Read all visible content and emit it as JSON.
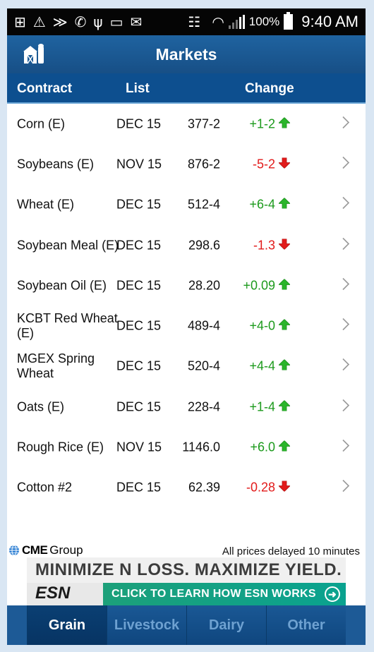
{
  "status_bar": {
    "icons": [
      "add-box-icon",
      "warning-icon",
      "sprint-icon",
      "missed-call-icon",
      "usb-icon",
      "voicemail-icon",
      "email-icon",
      "vibrate-icon",
      "wifi-icon",
      "signal-icon"
    ],
    "battery_pct": "100%",
    "time": "9:40 AM"
  },
  "header": {
    "title": "Markets",
    "logo_icon": "barn-silo-icon"
  },
  "columns": {
    "contract": "Contract",
    "list": "List",
    "change": "Change"
  },
  "colors": {
    "up": "#1c9a1c",
    "down": "#e21b1b",
    "header_bg": "#0d4f8f"
  },
  "markets": [
    {
      "contract": "Corn (E)",
      "list": "DEC 15",
      "price": "377-2",
      "change": "+1-2",
      "dir": "up"
    },
    {
      "contract": "Soybeans (E)",
      "list": "NOV 15",
      "price": "876-2",
      "change": "-5-2",
      "dir": "down"
    },
    {
      "contract": "Wheat (E)",
      "list": "DEC 15",
      "price": "512-4",
      "change": "+6-4",
      "dir": "up"
    },
    {
      "contract": "Soybean Meal (E)",
      "list": "DEC 15",
      "price": "298.6",
      "change": "-1.3",
      "dir": "down"
    },
    {
      "contract": "Soybean Oil (E)",
      "list": "DEC 15",
      "price": "28.20",
      "change": "+0.09",
      "dir": "up"
    },
    {
      "contract": "KCBT Red Wheat (E)",
      "list": "DEC 15",
      "price": "489-4",
      "change": "+4-0",
      "dir": "up"
    },
    {
      "contract": "MGEX Spring Wheat",
      "list": "DEC 15",
      "price": "520-4",
      "change": "+4-4",
      "dir": "up"
    },
    {
      "contract": "Oats (E)",
      "list": "DEC 15",
      "price": "228-4",
      "change": "+1-4",
      "dir": "up"
    },
    {
      "contract": "Rough Rice (E)",
      "list": "NOV 15",
      "price": "1146.0",
      "change": "+6.0",
      "dir": "up"
    },
    {
      "contract": "Cotton #2",
      "list": "DEC 15",
      "price": "62.39",
      "change": "-0.28",
      "dir": "down"
    }
  ],
  "footer": {
    "cme_brand_a": "CME",
    "cme_brand_b": "Group",
    "delay_note": "All prices delayed 10 minutes"
  },
  "ad": {
    "headline": "MINIMIZE N LOSS. MAXIMIZE YIELD.",
    "brand": "ESN",
    "cta": "CLICK TO LEARN HOW ESN WORKS"
  },
  "tabs": [
    {
      "label": "Grain",
      "active": true
    },
    {
      "label": "Livestock",
      "active": false
    },
    {
      "label": "Dairy",
      "active": false
    },
    {
      "label": "Other",
      "active": false
    }
  ]
}
